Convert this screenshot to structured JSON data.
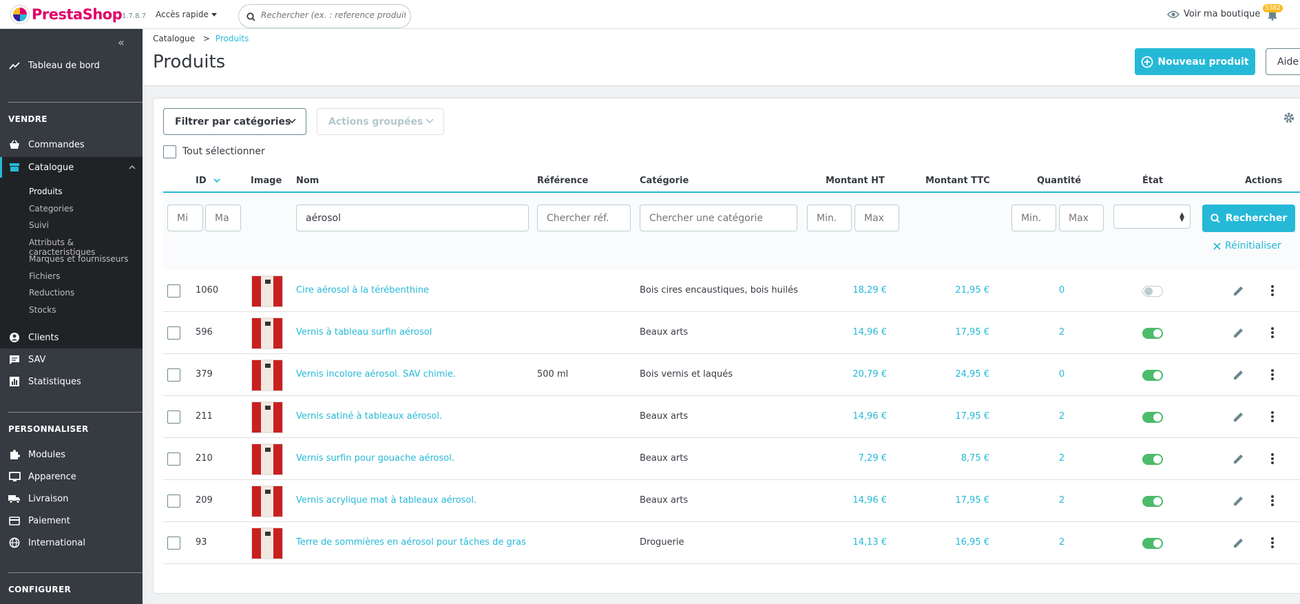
{
  "header": {
    "logo_text_presta": "Presta",
    "logo_text_shop": "Shop",
    "version": "1.7.8.7",
    "quick_access": "Accès rapide",
    "search_placeholder": "Rechercher (ex. : reference produit, no",
    "view_shop": "Voir ma boutique",
    "notifications_count": "5382"
  },
  "sidebar": {
    "dashboard": "Tableau de bord",
    "section_sell": "VENDRE",
    "orders": "Commandes",
    "catalog": "Catalogue",
    "catalog_sub": [
      "Produits",
      "Categories",
      "Suivi",
      "Attributs & caracteristiques",
      "Marques et fournisseurs",
      "Fichiers",
      "Reductions",
      "Stocks"
    ],
    "customers": "Clients",
    "support": "SAV",
    "stats": "Statistiques",
    "section_customize": "PERSONNALISER",
    "modules": "Modules",
    "appearance": "Apparence",
    "shipping": "Livraison",
    "payment": "Paiement",
    "international": "International",
    "section_configure": "CONFIGURER"
  },
  "page": {
    "breadcrumb_parent": "Catalogue",
    "breadcrumb_sep": ">",
    "breadcrumb_current": "Produits",
    "title": "Produits",
    "new_product": "Nouveau produit",
    "help": "Aide"
  },
  "toolbar": {
    "filter_categories": "Filtrer par catégories",
    "bulk_actions": "Actions groupées",
    "select_all": "Tout sélectionner"
  },
  "table": {
    "headers": {
      "id": "ID",
      "image": "Image",
      "name": "Nom",
      "reference": "Référence",
      "category": "Catégorie",
      "price_ht": "Montant HT",
      "price_ttc": "Montant TTC",
      "quantity": "Quantité",
      "status": "État",
      "actions": "Actions"
    },
    "filters": {
      "id_min_placeholder": "Mi",
      "id_max_placeholder": "Ma",
      "name_value": "aérosol",
      "reference_placeholder": "Chercher réf.",
      "category_placeholder": "Chercher une catégorie",
      "price_min_placeholder": "Min.",
      "price_max_placeholder": "Max",
      "qty_min_placeholder": "Min.",
      "qty_max_placeholder": "Max",
      "search_button": "Rechercher",
      "reset_button": "Réinitialiser"
    },
    "rows": [
      {
        "id": "1060",
        "name": "Cire aérosol à la térébenthine",
        "reference": "",
        "category": "Bois cires encaustiques, bois huilés",
        "price_ht": "18,29 €",
        "price_ttc": "21,95 €",
        "quantity": "0",
        "active": false
      },
      {
        "id": "596",
        "name": "Vernis à tableau surfin aérosol",
        "reference": "",
        "category": "Beaux arts",
        "price_ht": "14,96 €",
        "price_ttc": "17,95 €",
        "quantity": "2",
        "active": true
      },
      {
        "id": "379",
        "name": "Vernis incolore aérosol. SAV chimie.",
        "reference": "500 ml",
        "category": "Bois vernis et laqués",
        "price_ht": "20,79 €",
        "price_ttc": "24,95 €",
        "quantity": "0",
        "active": true
      },
      {
        "id": "211",
        "name": "Vernis satiné à tableaux aérosol.",
        "reference": "",
        "category": "Beaux arts",
        "price_ht": "14,96 €",
        "price_ttc": "17,95 €",
        "quantity": "2",
        "active": true
      },
      {
        "id": "210",
        "name": "Vernis surfin pour gouache aérosol.",
        "reference": "",
        "category": "Beaux arts",
        "price_ht": "7,29 €",
        "price_ttc": "8,75 €",
        "quantity": "2",
        "active": true
      },
      {
        "id": "209",
        "name": "Vernis acrylique mat à tableaux aérosol.",
        "reference": "",
        "category": "Beaux arts",
        "price_ht": "14,96 €",
        "price_ttc": "17,95 €",
        "quantity": "2",
        "active": true
      },
      {
        "id": "93",
        "name": "Terre de sommières en aérosol pour tâches de gras",
        "reference": "",
        "category": "Droguerie",
        "price_ht": "14,13 €",
        "price_ttc": "16,95 €",
        "quantity": "2",
        "active": true
      }
    ]
  },
  "colors": {
    "primary": "#25b9d7",
    "sidebar": "#363a41",
    "toggle_on": "#4cbb6c",
    "brand": "#df0067"
  }
}
